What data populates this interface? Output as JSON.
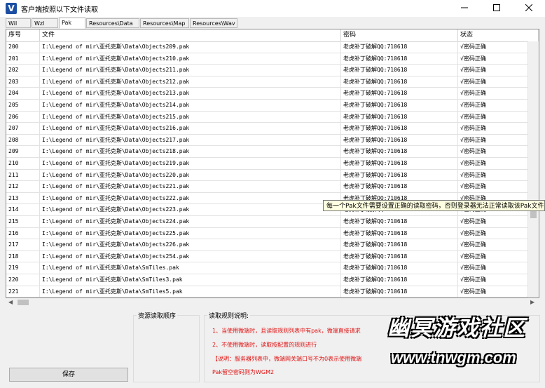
{
  "window": {
    "title": "客户端按照以下文件读取",
    "icon": "V"
  },
  "tabs": [
    {
      "label": "Wil"
    },
    {
      "label": "Wzl"
    },
    {
      "label": "Pak"
    },
    {
      "label": "Resources\\Data"
    },
    {
      "label": "Resources\\Map"
    },
    {
      "label": "Resources\\Wav"
    }
  ],
  "table": {
    "headers": {
      "index": "序号",
      "file": "文件",
      "password": "密码",
      "status": "状态"
    },
    "rows": [
      {
        "index": "200",
        "file": "I:\\Legend of mir\\亚托克斯\\Data\\Objects209.pak",
        "password": "老虎补丁破解QQ:710618",
        "status": "√密码正确"
      },
      {
        "index": "201",
        "file": "I:\\Legend of mir\\亚托克斯\\Data\\Objects210.pak",
        "password": "老虎补丁破解QQ:710618",
        "status": "√密码正确"
      },
      {
        "index": "202",
        "file": "I:\\Legend of mir\\亚托克斯\\Data\\Objects211.pak",
        "password": "老虎补丁破解QQ:710618",
        "status": "√密码正确"
      },
      {
        "index": "203",
        "file": "I:\\Legend of mir\\亚托克斯\\Data\\Objects212.pak",
        "password": "老虎补丁破解QQ:710618",
        "status": "√密码正确"
      },
      {
        "index": "204",
        "file": "I:\\Legend of mir\\亚托克斯\\Data\\Objects213.pak",
        "password": "老虎补丁破解QQ:710618",
        "status": "√密码正确"
      },
      {
        "index": "205",
        "file": "I:\\Legend of mir\\亚托克斯\\Data\\Objects214.pak",
        "password": "老虎补丁破解QQ:710618",
        "status": "√密码正确"
      },
      {
        "index": "206",
        "file": "I:\\Legend of mir\\亚托克斯\\Data\\Objects215.pak",
        "password": "老虎补丁破解QQ:710618",
        "status": "√密码正确"
      },
      {
        "index": "207",
        "file": "I:\\Legend of mir\\亚托克斯\\Data\\Objects216.pak",
        "password": "老虎补丁破解QQ:710618",
        "status": "√密码正确"
      },
      {
        "index": "208",
        "file": "I:\\Legend of mir\\亚托克斯\\Data\\Objects217.pak",
        "password": "老虎补丁破解QQ:710618",
        "status": "√密码正确"
      },
      {
        "index": "209",
        "file": "I:\\Legend of mir\\亚托克斯\\Data\\Objects218.pak",
        "password": "老虎补丁破解QQ:710618",
        "status": "√密码正确"
      },
      {
        "index": "210",
        "file": "I:\\Legend of mir\\亚托克斯\\Data\\Objects219.pak",
        "password": "老虎补丁破解QQ:710618",
        "status": "√密码正确"
      },
      {
        "index": "211",
        "file": "I:\\Legend of mir\\亚托克斯\\Data\\Objects220.pak",
        "password": "老虎补丁破解QQ:710618",
        "status": "√密码正确"
      },
      {
        "index": "212",
        "file": "I:\\Legend of mir\\亚托克斯\\Data\\Objects221.pak",
        "password": "老虎补丁破解QQ:710618",
        "status": "√密码正确"
      },
      {
        "index": "213",
        "file": "I:\\Legend of mir\\亚托克斯\\Data\\Objects222.pak",
        "password": "老虎补丁破解QQ:710618",
        "status": "√密码正确"
      },
      {
        "index": "214",
        "file": "I:\\Legend of mir\\亚托克斯\\Data\\Objects223.pak",
        "password": "老虎补丁破解QQ:710618",
        "status": "√密码正确"
      },
      {
        "index": "215",
        "file": "I:\\Legend of mir\\亚托克斯\\Data\\Objects224.pak",
        "password": "老虎补丁破解QQ:710618",
        "status": "√密码正确"
      },
      {
        "index": "216",
        "file": "I:\\Legend of mir\\亚托克斯\\Data\\Objects225.pak",
        "password": "老虎补丁破解QQ:710618",
        "status": "√密码正确"
      },
      {
        "index": "217",
        "file": "I:\\Legend of mir\\亚托克斯\\Data\\Objects226.pak",
        "password": "老虎补丁破解QQ:710618",
        "status": "√密码正确"
      },
      {
        "index": "218",
        "file": "I:\\Legend of mir\\亚托克斯\\Data\\Objects254.pak",
        "password": "老虎补丁破解QQ:710618",
        "status": "√密码正确"
      },
      {
        "index": "219",
        "file": "I:\\Legend of mir\\亚托克斯\\Data\\SmTiles.pak",
        "password": "老虎补丁破解QQ:710618",
        "status": "√密码正确"
      },
      {
        "index": "220",
        "file": "I:\\Legend of mir\\亚托克斯\\Data\\SmTiles3.pak",
        "password": "老虎补丁破解QQ:710618",
        "status": "√密码正确"
      },
      {
        "index": "221",
        "file": "I:\\Legend of mir\\亚托克斯\\Data\\SmTiles5.pak",
        "password": "老虎补丁破解QQ:710618",
        "status": "√密码正确"
      }
    ]
  },
  "tooltip": "每一个Pak文件需要设置正确的读取密码，否则登录器无法正常读取该Pak文件",
  "bottom": {
    "save_label": "保存",
    "resource_order_title": "资源读取顺序",
    "rules_title": "读取规则说明:",
    "rules": [
      "1、当使用微端时，且读取规则列表中有pak，微端直接请求",
      "2、不使用微端时，读取按配置的规则进行",
      "【说明：服务器列表中，微端网关端口号不为0表示使用微端",
      "Pak留空密码则为WGM2"
    ]
  },
  "watermark": {
    "title": "幽冥游戏社区",
    "url": "www.tnwgm.com"
  },
  "colors": {
    "rules_text": "#e01010",
    "tooltip_bg": "#ffffe1",
    "app_icon": "#1c4fa3"
  }
}
